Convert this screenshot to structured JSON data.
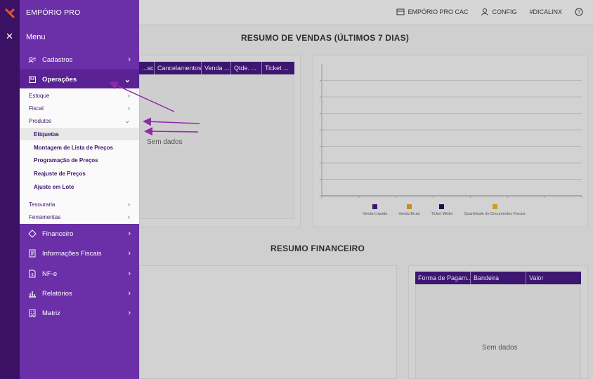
{
  "brand": "EMPÓRIO PRO",
  "menu_title": "Menu",
  "top_actions": {
    "store": "EMPÓRIO PRO CAC",
    "config": "CONFIG",
    "hashtag": "#DICALINX"
  },
  "menu_items": [
    {
      "label": "Cadastros",
      "icon": "address-card-icon"
    },
    {
      "label": "Operações",
      "icon": "box-icon"
    },
    {
      "label": "Financeiro",
      "icon": "diamond-icon"
    },
    {
      "label": "Informações Fiscais",
      "icon": "document-icon"
    },
    {
      "label": "NF-e",
      "icon": "nfe-icon"
    },
    {
      "label": "Relatórios",
      "icon": "bar-chart-icon"
    },
    {
      "label": "Matriz",
      "icon": "building-icon"
    }
  ],
  "submenu": {
    "estoque": "Estoque",
    "fiscal": "Fiscal",
    "produtos": "Produtos",
    "produtos_items": [
      "Etiquetas",
      "Montagem de Lista de Preços",
      "Programação de Preços",
      "Reajuste de Preços",
      "Ajuste em Lote"
    ],
    "tesouraria": "Tesouraria",
    "ferramentas": "Ferramentas"
  },
  "sales": {
    "title": "RESUMO DE VENDAS (ÚLTIMOS 7 DIAS)",
    "columns": [
      "...sci...",
      "Cancelamentos",
      "Venda ...",
      "Qtde. ...",
      "Ticket ..."
    ],
    "empty": "Sem dados"
  },
  "financial": {
    "title": "RESUMO FINANCEIRO",
    "columns": [
      "Forma de Pagam...",
      "Bandeira",
      "Valor"
    ],
    "empty": "Sem dados"
  },
  "chart_data": {
    "type": "bar",
    "categories": [],
    "series": [
      {
        "name": "Venda Líquida",
        "color": "#3c1670",
        "values": []
      },
      {
        "name": "Venda Bruta",
        "color": "#c98c1e",
        "values": []
      },
      {
        "name": "Ticket Médio",
        "color": "#1f0f4a",
        "values": []
      },
      {
        "name": "Quantidade de Documentos Fiscais",
        "color": "#c9a01e",
        "values": []
      }
    ],
    "legend": "bottom",
    "grid": true
  }
}
